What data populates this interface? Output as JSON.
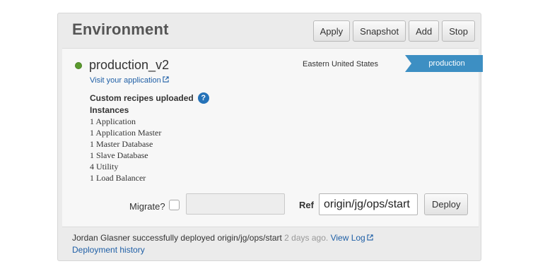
{
  "panel": {
    "title": "Environment",
    "toolbar": {
      "apply_label": "Apply",
      "snapshot_label": "Snapshot",
      "add_label": "Add",
      "stop_label": "Stop"
    }
  },
  "environment": {
    "name": "production_v2",
    "status_color": "#5a9a2d",
    "visit_link": "Visit your application",
    "region": "Eastern United States",
    "framework_env": "production",
    "framework_env_color": "#3d8fc3",
    "recipes_text": "Custom recipes uploaded",
    "help_icon_glyph": "?",
    "instances_heading": "Instances",
    "instances": [
      "1 Application",
      "1 Application Master",
      "1 Master Database",
      "1 Slave Database",
      "4 Utility",
      "1 Load Balancer"
    ]
  },
  "deploy_form": {
    "migrate_label": "Migrate?",
    "migrate_checked": false,
    "migrate_command": "",
    "ref_label": "Ref",
    "ref_value": "origin/jg/ops/start",
    "deploy_label": "Deploy"
  },
  "footer": {
    "message": "Jordan Glasner successfully deployed origin/jg/ops/start",
    "time_ago": "2 days ago.",
    "view_log": "View Log",
    "history_link": "Deployment history"
  }
}
